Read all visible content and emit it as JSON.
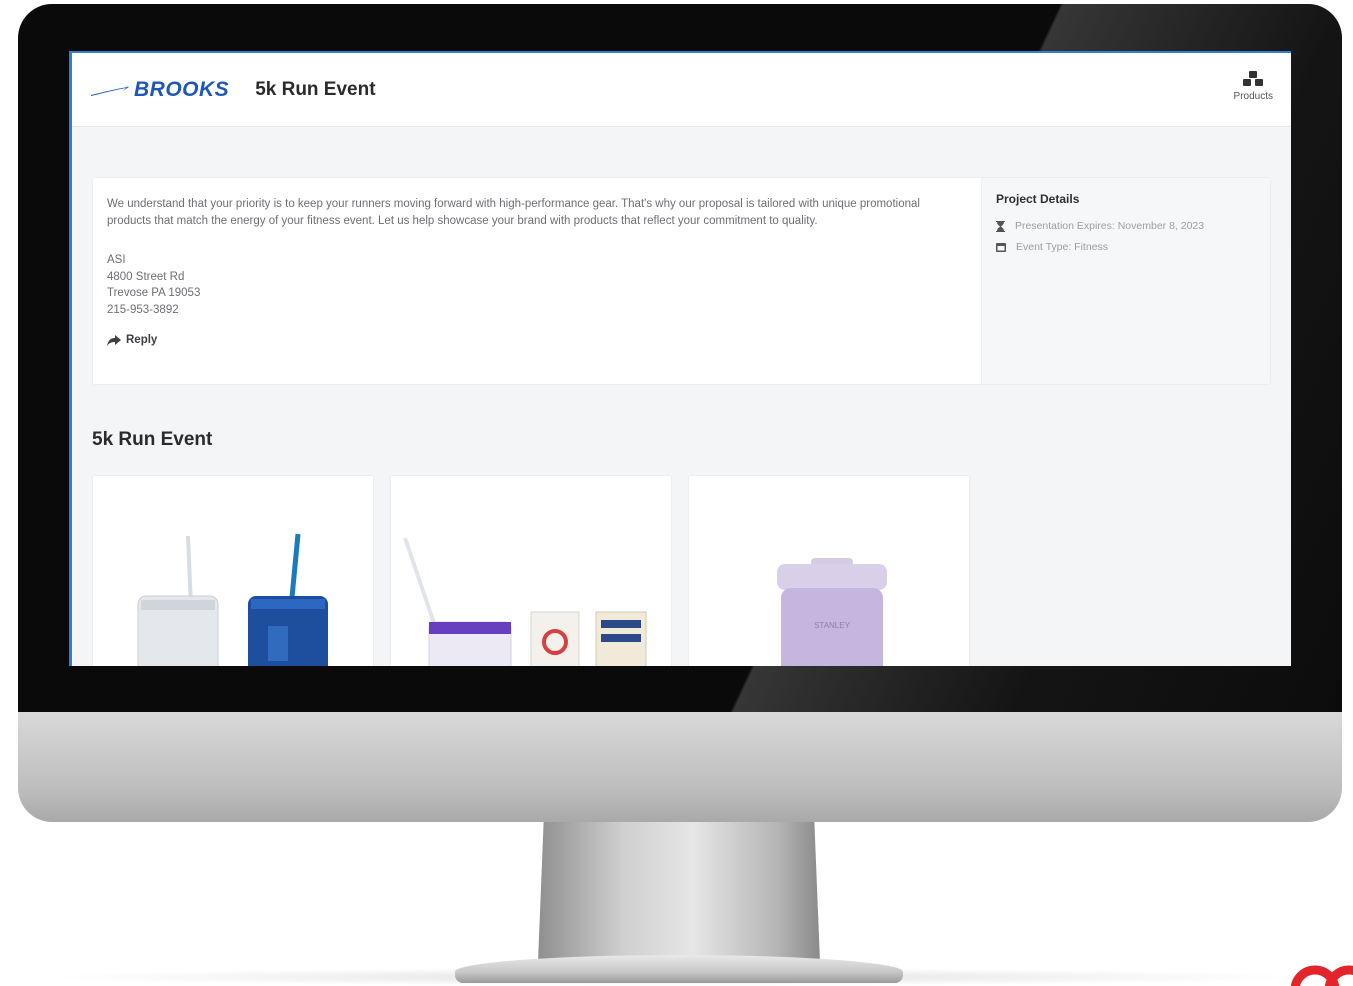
{
  "header": {
    "brand_name": "BROOKS",
    "event_title": "5k Run Event",
    "products_label": "Products"
  },
  "message": {
    "intro": "We understand that your priority is to keep your runners moving forward with high-performance gear. That's why our proposal is tailored with unique promotional products that match the energy of your fitness event. Let us help showcase your brand with products that reflect your commitment to quality.",
    "company": "ASI",
    "street": "4800 Street Rd",
    "city": "Trevose PA 19053",
    "phone": "215-953-3892",
    "reply_label": "Reply"
  },
  "project_details": {
    "title": "Project Details",
    "expires": "Presentation Expires: November 8, 2023",
    "event_type": "Event Type: Fitness"
  },
  "section": {
    "title": "5k Run Event"
  },
  "products": [
    {
      "name": "tumblers-with-straws"
    },
    {
      "name": "cups-set"
    },
    {
      "name": "stanley-jug"
    }
  ],
  "colors": {
    "brand": "#1f57b5",
    "accent_line": "#2f7fd6",
    "corner_logo": "#e3242b"
  }
}
